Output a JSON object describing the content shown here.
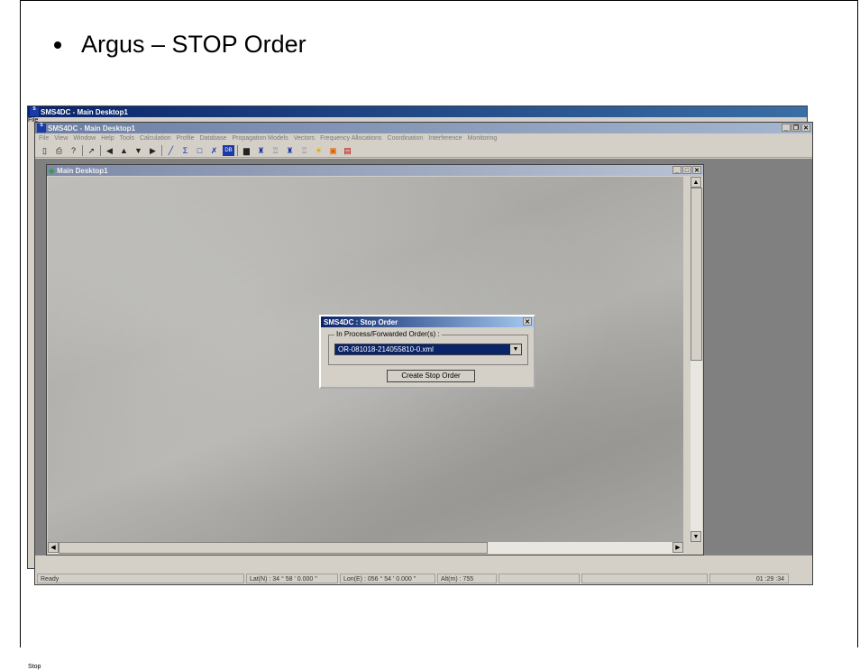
{
  "slide": {
    "title": "Argus – STOP Order"
  },
  "app": {
    "back_window_title": "SMS4DC - Main Desktop1",
    "back_menu_stub": "File",
    "back_status_stub": "Stop",
    "window_title": "SMS4DC - Main Desktop1",
    "icon_text": "SMS 4DC",
    "menu": [
      "File",
      "View",
      "Window",
      "Help",
      "Tools",
      "Calculation",
      "Profile",
      "Database",
      "Propagation Models",
      "Vectors",
      "Frequency Allocations",
      "Coordination",
      "Interference",
      "Monitoring"
    ],
    "child_window_title": "Main Desktop1",
    "statusbar": {
      "ready": "Ready",
      "lat": "Lat(N) : 34 ° 58 ' 0.000 \"",
      "lon": "Lon(E) : 056 ° 54 ' 0.000 \"",
      "alt": "Alt(m) : 755",
      "time": "01 :29 :34"
    }
  },
  "dialog": {
    "title": "SMS4DC : Stop Order",
    "group_label": "In Process/Forwarded Order(s) :",
    "selected_order": "OR-081018-214055810-0.xml",
    "button_label": "Create Stop Order"
  },
  "icons": {
    "toolbar": [
      "new-file-icon",
      "print-icon",
      "help-icon",
      "pointer-icon",
      "arrow-left-icon",
      "arrow-up-icon",
      "arrow-down-icon",
      "arrow-right-icon",
      "line-icon",
      "sum-icon",
      "rectangle-icon",
      "xy-icon",
      "db-icon",
      "chart-icon",
      "tower-icon",
      "tower-outline-icon",
      "tower-red-icon",
      "tower-gray-icon",
      "sun-icon",
      "window-icon",
      "palette-icon"
    ]
  }
}
